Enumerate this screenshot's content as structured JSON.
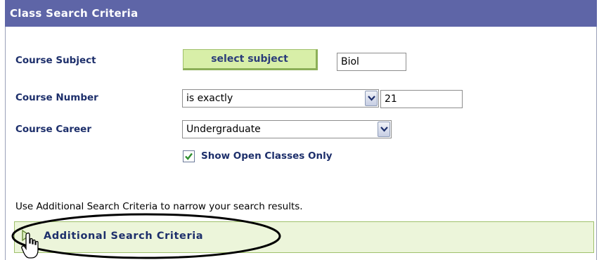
{
  "header": {
    "title": "Class Search Criteria"
  },
  "course_subject": {
    "label": "Course Subject",
    "button_label": "select subject",
    "value": "Biol"
  },
  "course_number": {
    "label": "Course Number",
    "operator": "is exactly",
    "value": "21"
  },
  "course_career": {
    "label": "Course Career",
    "value": "Undergraduate"
  },
  "open_only": {
    "label": "Show Open Classes Only",
    "checked": true
  },
  "hint_text": "Use Additional Search Criteria to narrow your search results.",
  "additional": {
    "title": "Additional Search Criteria",
    "icon": "expand-triangle-icon"
  },
  "colors": {
    "header_bg": "#5e65a7",
    "label": "#1d2f6b",
    "button_bg": "#d8efa8",
    "section_bg": "#ecf5da"
  }
}
